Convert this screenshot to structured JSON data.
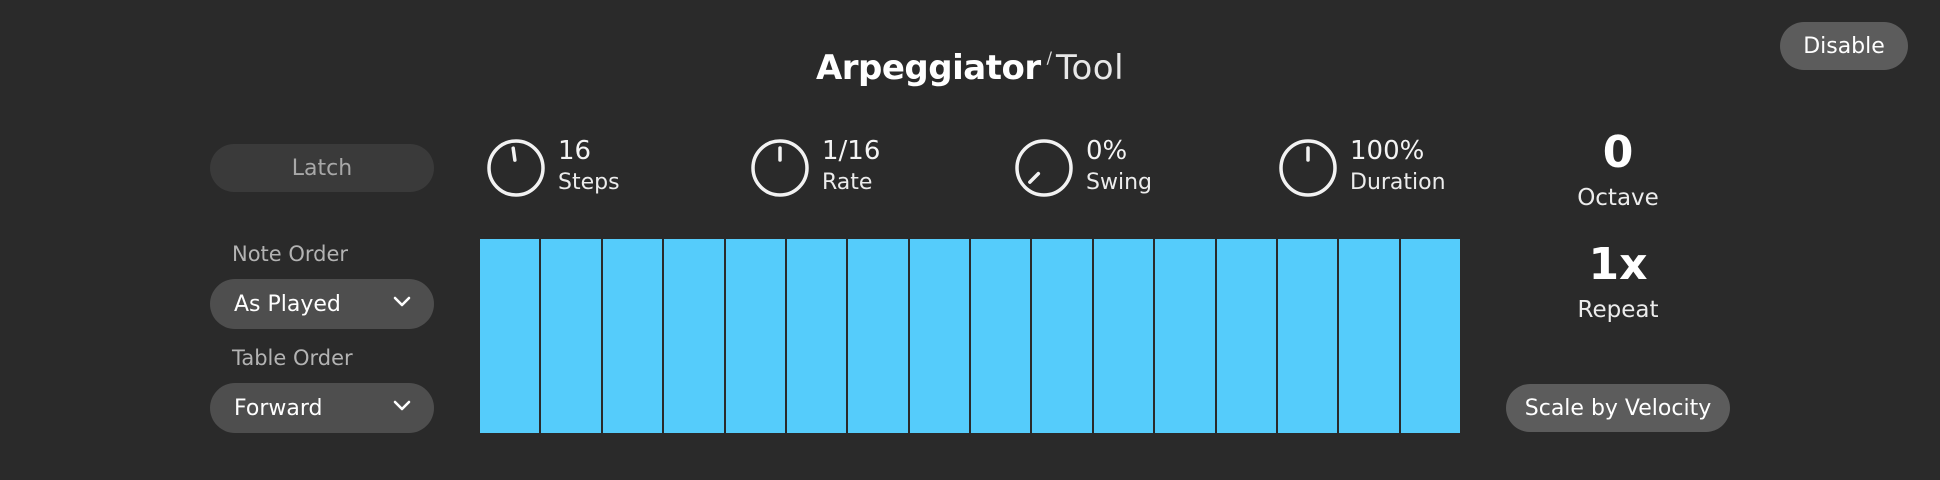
{
  "header": {
    "title_brand": "Arpeggiator",
    "title_slash": "/",
    "title_tool": "Tool",
    "disable_label": "Disable"
  },
  "left_panel": {
    "latch_label": "Latch",
    "note_order": {
      "label": "Note Order",
      "value": "As Played"
    },
    "table_order": {
      "label": "Table Order",
      "value": "Forward"
    }
  },
  "knobs": [
    {
      "value": "16",
      "label": "Steps",
      "level": 0.47
    },
    {
      "value": "1/16",
      "label": "Rate",
      "level": 0.5
    },
    {
      "value": "0%",
      "label": "Swing",
      "level": 0.0
    },
    {
      "value": "100%",
      "label": "Duration",
      "level": 0.5
    }
  ],
  "step_grid": {
    "count": 16,
    "color": "#55ccfb",
    "levels": [
      1,
      1,
      1,
      1,
      1,
      1,
      1,
      1,
      1,
      1,
      1,
      1,
      1,
      1,
      1,
      1
    ]
  },
  "right_panel": {
    "octave": {
      "value": "0",
      "label": "Octave"
    },
    "repeat": {
      "value": "1x",
      "label": "Repeat"
    },
    "scale_velocity_label": "Scale by Velocity"
  },
  "colors": {
    "background": "#2a2a2a",
    "accent": "#55ccfb",
    "button": "#5c5c5c"
  },
  "icons": {
    "dropdown": "chevron-down-icon",
    "knob": "knob-icon"
  }
}
